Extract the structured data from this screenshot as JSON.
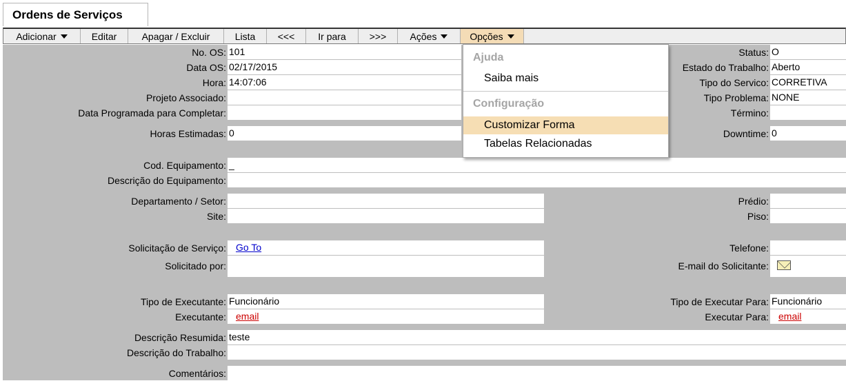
{
  "window": {
    "title": "Ordens de Serviços"
  },
  "menu": [
    {
      "label": "Adicionar",
      "dropdown": true
    },
    {
      "label": "Editar"
    },
    {
      "label": "Apagar / Excluir"
    },
    {
      "label": "Lista"
    },
    {
      "label": "<<<"
    },
    {
      "label": "Ir para"
    },
    {
      "label": ">>>"
    },
    {
      "label": "Ações",
      "dropdown": true
    },
    {
      "label": "Opções",
      "dropdown": true,
      "active": true
    }
  ],
  "dropdown": {
    "sections": [
      {
        "header": "Ajuda",
        "items": [
          {
            "label": "Saiba mais"
          }
        ]
      },
      {
        "header": "Configuração",
        "items": [
          {
            "label": "Customizar Forma",
            "highlighted": true
          },
          {
            "label": "Tabelas Relacionadas"
          }
        ]
      }
    ]
  },
  "form": {
    "no_os": {
      "label": "No. OS:",
      "value": "101"
    },
    "data_os": {
      "label": "Data OS:",
      "value": "02/17/2015"
    },
    "hora": {
      "label": "Hora:",
      "value": "14:07:06"
    },
    "projeto": {
      "label": "Projeto Associado:",
      "value": ""
    },
    "data_prog": {
      "label": "Data Programada para Completar:",
      "value": ""
    },
    "horas_est": {
      "label": "Horas Estimadas:",
      "value": "0"
    },
    "status": {
      "label": "Status:",
      "value": "O"
    },
    "estado": {
      "label": "Estado do Trabalho:",
      "value": "Aberto"
    },
    "tipo_servico": {
      "label": "Tipo do Servico:",
      "value": "CORRETIVA"
    },
    "tipo_problema": {
      "label": "Tipo Problema:",
      "value": "NONE"
    },
    "termino": {
      "label": "Término:",
      "value": ""
    },
    "downtime": {
      "label": "Downtime:",
      "value": "0"
    },
    "cod_equip": {
      "label": "Cod. Equipamento:",
      "value": "_"
    },
    "desc_equip": {
      "label": "Descrição do Equipamento:",
      "value": ""
    },
    "departamento": {
      "label": "Departamento / Setor:",
      "value": ""
    },
    "site": {
      "label": "Site:",
      "value": ""
    },
    "predio": {
      "label": "Prédio:",
      "value": ""
    },
    "piso": {
      "label": "Piso:",
      "value": ""
    },
    "solicitacao": {
      "label": "Solicitação de Serviço:",
      "link": "Go To"
    },
    "solicitado_por": {
      "label": "Solicitado por:",
      "value": ""
    },
    "telefone": {
      "label": "Telefone:",
      "value": ""
    },
    "email_solicitante": {
      "label": "E-mail do Solicitante:"
    },
    "tipo_executante": {
      "label": "Tipo de Executante:",
      "value": "Funcionário"
    },
    "executante": {
      "label": "Executante:",
      "link": "email"
    },
    "tipo_executar_para": {
      "label": "Tipo de Executar Para:",
      "value": "Funcionário"
    },
    "executar_para": {
      "label": "Executar Para:",
      "link": "email"
    },
    "desc_resumida": {
      "label": "Descrição Resumida:",
      "value": "teste"
    },
    "desc_trabalho": {
      "label": "Descrição do Trabalho:",
      "value": ""
    },
    "comentarios": {
      "label": "Comentários:",
      "value": ""
    }
  }
}
